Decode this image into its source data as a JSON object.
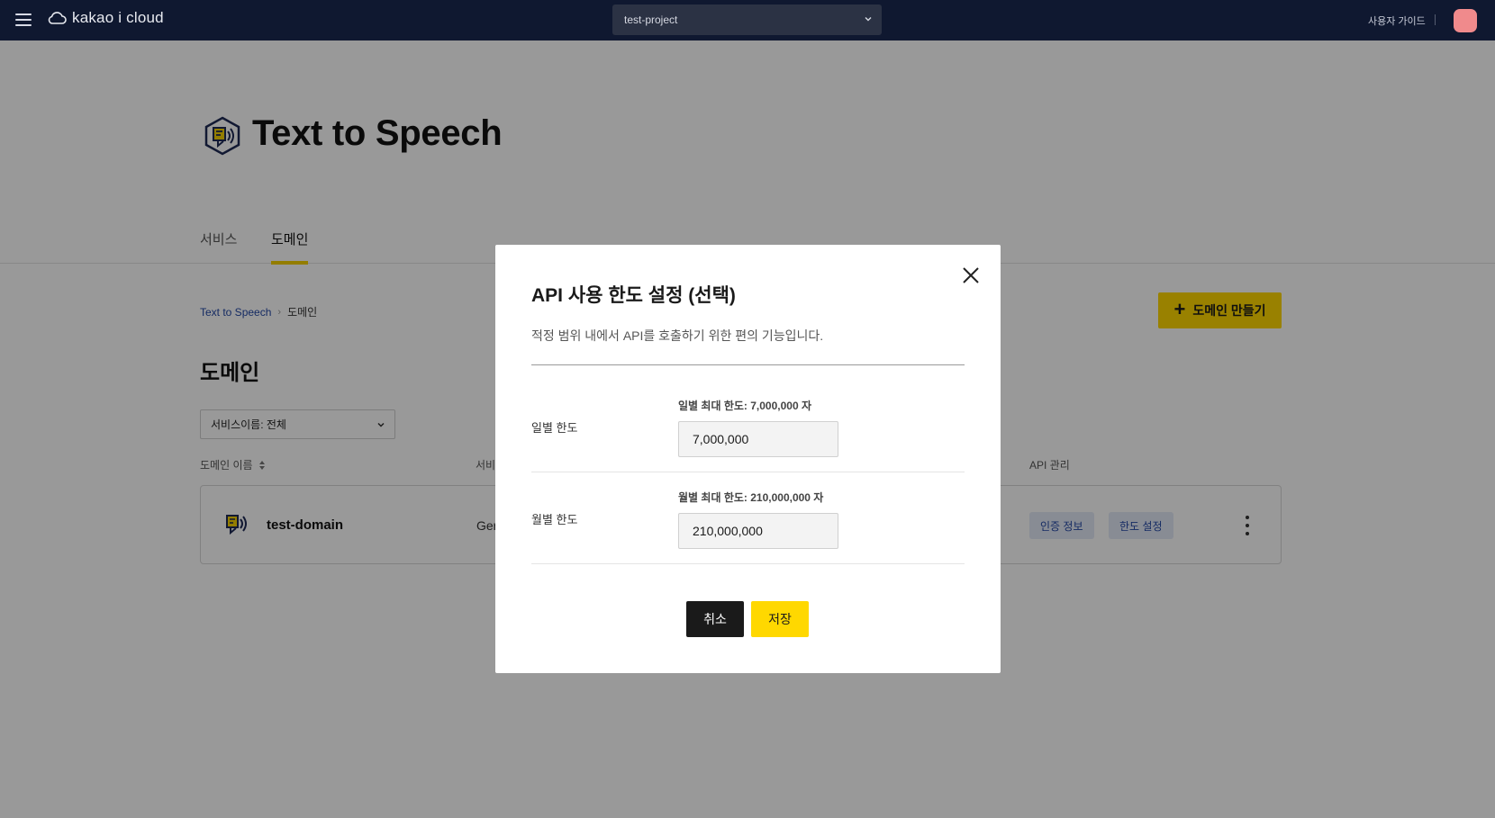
{
  "topbar": {
    "brand": "kakao i cloud",
    "project": "test-project",
    "guide_label": "사용자 가이드",
    "avatar_color": "#f08a8c"
  },
  "header": {
    "title": "Text to Speech",
    "tabs": [
      {
        "label": "서비스",
        "active": false
      },
      {
        "label": "도메인",
        "active": true
      }
    ]
  },
  "breadcrumb": {
    "items": [
      "Text to Speech",
      "도메인"
    ]
  },
  "actions": {
    "create_label": "도메인 만들기"
  },
  "section": {
    "title": "도메인",
    "filter_value": "서비스이름: 전체"
  },
  "table": {
    "columns": [
      "도메인 이름",
      "서비",
      "API 관리"
    ],
    "rows": [
      {
        "name": "test-domain",
        "service": "Ger",
        "chips": [
          "인증 정보",
          "한도 설정"
        ]
      }
    ]
  },
  "modal": {
    "title": "API 사용 한도 설정 (선택)",
    "description": "적정 범위 내에서 API를 호출하기 위한 편의 기능입니다.",
    "daily": {
      "label": "일별 한도",
      "hint": "일별 최대 한도: 7,000,000 자",
      "value": "7,000,000"
    },
    "monthly": {
      "label": "월별 한도",
      "hint": "월별 최대 한도: 210,000,000 자",
      "value": "210,000,000"
    },
    "cancel_label": "취소",
    "save_label": "저장"
  },
  "colors": {
    "accent": "#ffd800",
    "topbar": "#0f1830",
    "link": "#2448a6",
    "chip_bg": "#e3e9f7"
  }
}
